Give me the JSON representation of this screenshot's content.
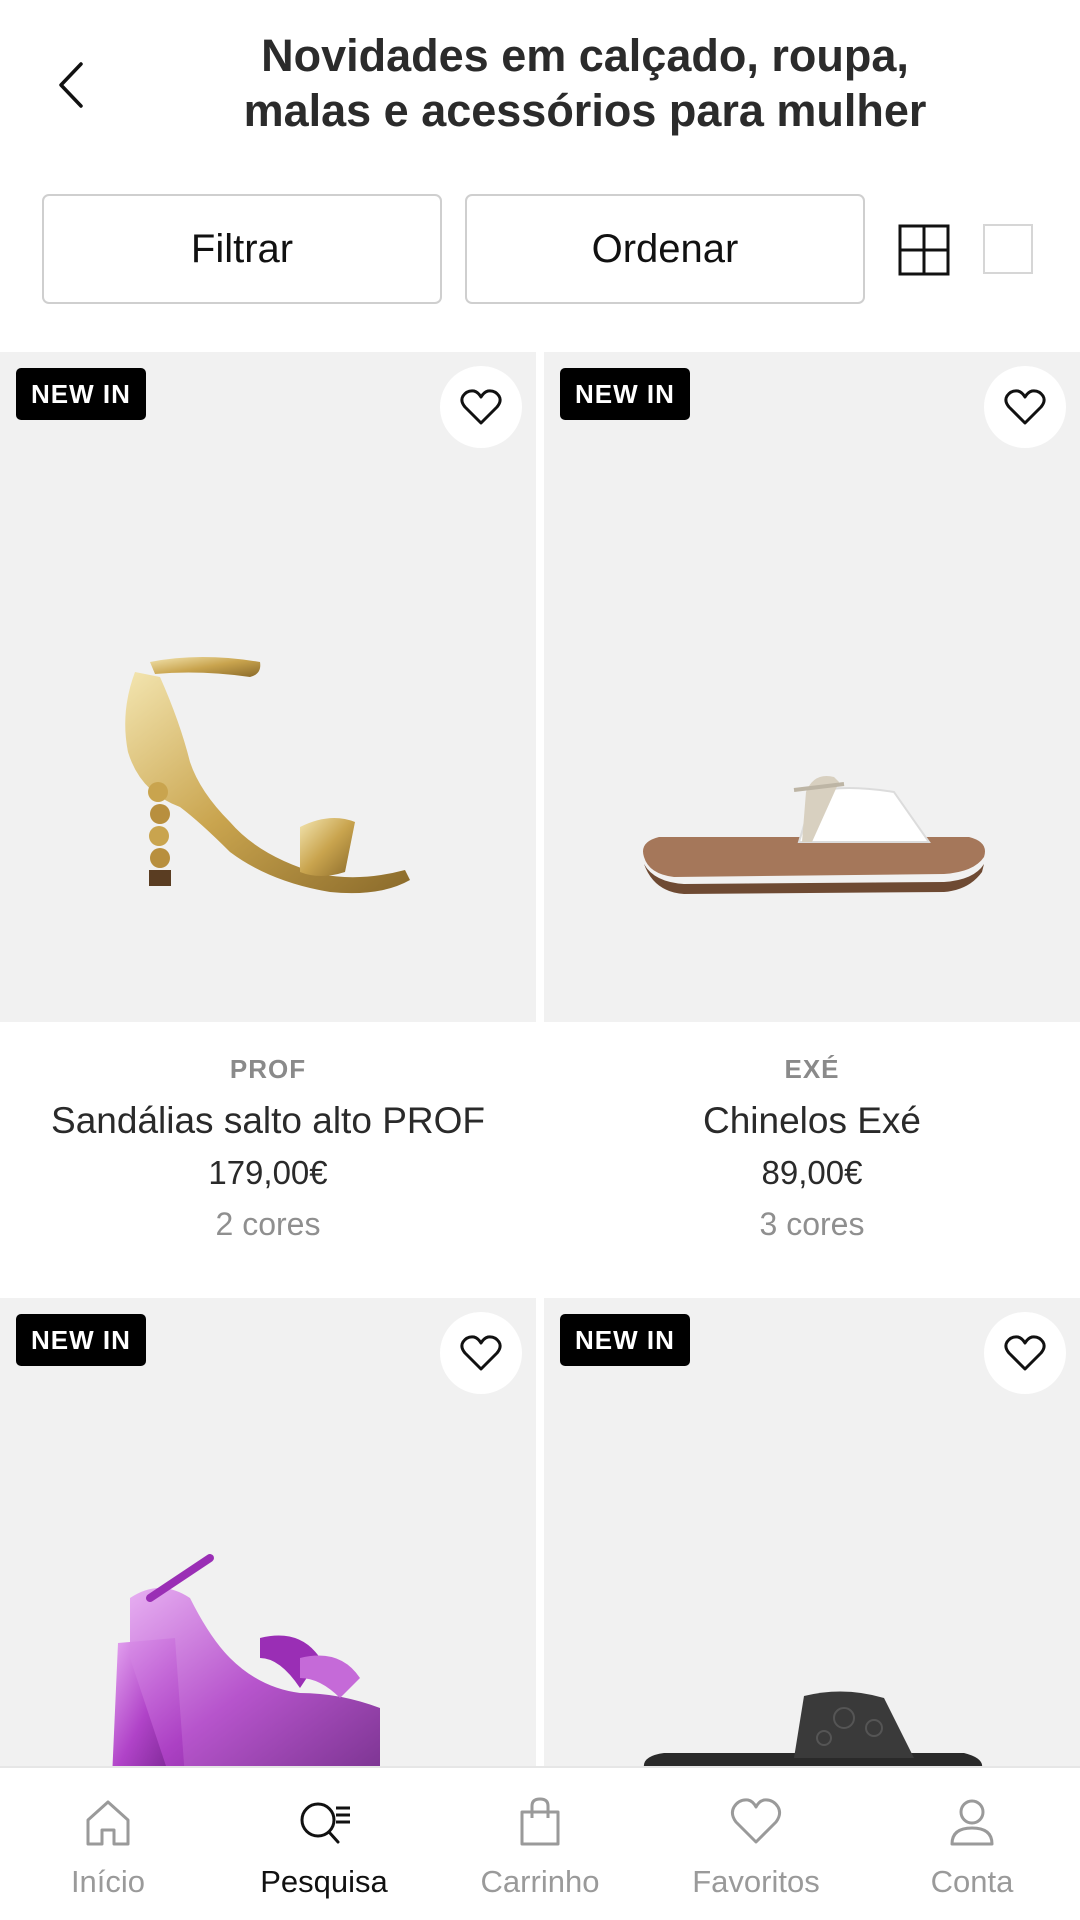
{
  "header": {
    "title_line1": "Novidades em calçado, roupa,",
    "title_line2": "malas e acessórios para mulher"
  },
  "toolbar": {
    "filter_label": "Filtrar",
    "sort_label": "Ordenar",
    "view_options": [
      "grid-view-icon",
      "single-view-icon"
    ]
  },
  "products": [
    {
      "badge": "NEW IN",
      "brand": "PROF",
      "name": "Sandálias salto alto PROF",
      "price": "179,00€",
      "colors": "2 cores",
      "image": "gold-heeled-sandal"
    },
    {
      "badge": "NEW IN",
      "brand": "EXÉ",
      "name": "Chinelos Exé",
      "price": "89,00€",
      "colors": "3 cores",
      "image": "white-flat-slide"
    },
    {
      "badge": "NEW IN",
      "image": "purple-platform-sandal"
    },
    {
      "badge": "NEW IN",
      "image": "black-embossed-slide"
    }
  ],
  "bottom_nav": [
    {
      "label": "Início",
      "icon": "home-icon",
      "active": false
    },
    {
      "label": "Pesquisa",
      "icon": "search-list-icon",
      "active": true
    },
    {
      "label": "Carrinho",
      "icon": "bag-icon",
      "active": false
    },
    {
      "label": "Favoritos",
      "icon": "heart-icon",
      "active": false
    },
    {
      "label": "Conta",
      "icon": "user-icon",
      "active": false
    }
  ],
  "colors": {
    "accent": "#000000",
    "text": "#222222",
    "muted": "#9a9a9a",
    "image_bg": "#f1f1f1"
  }
}
